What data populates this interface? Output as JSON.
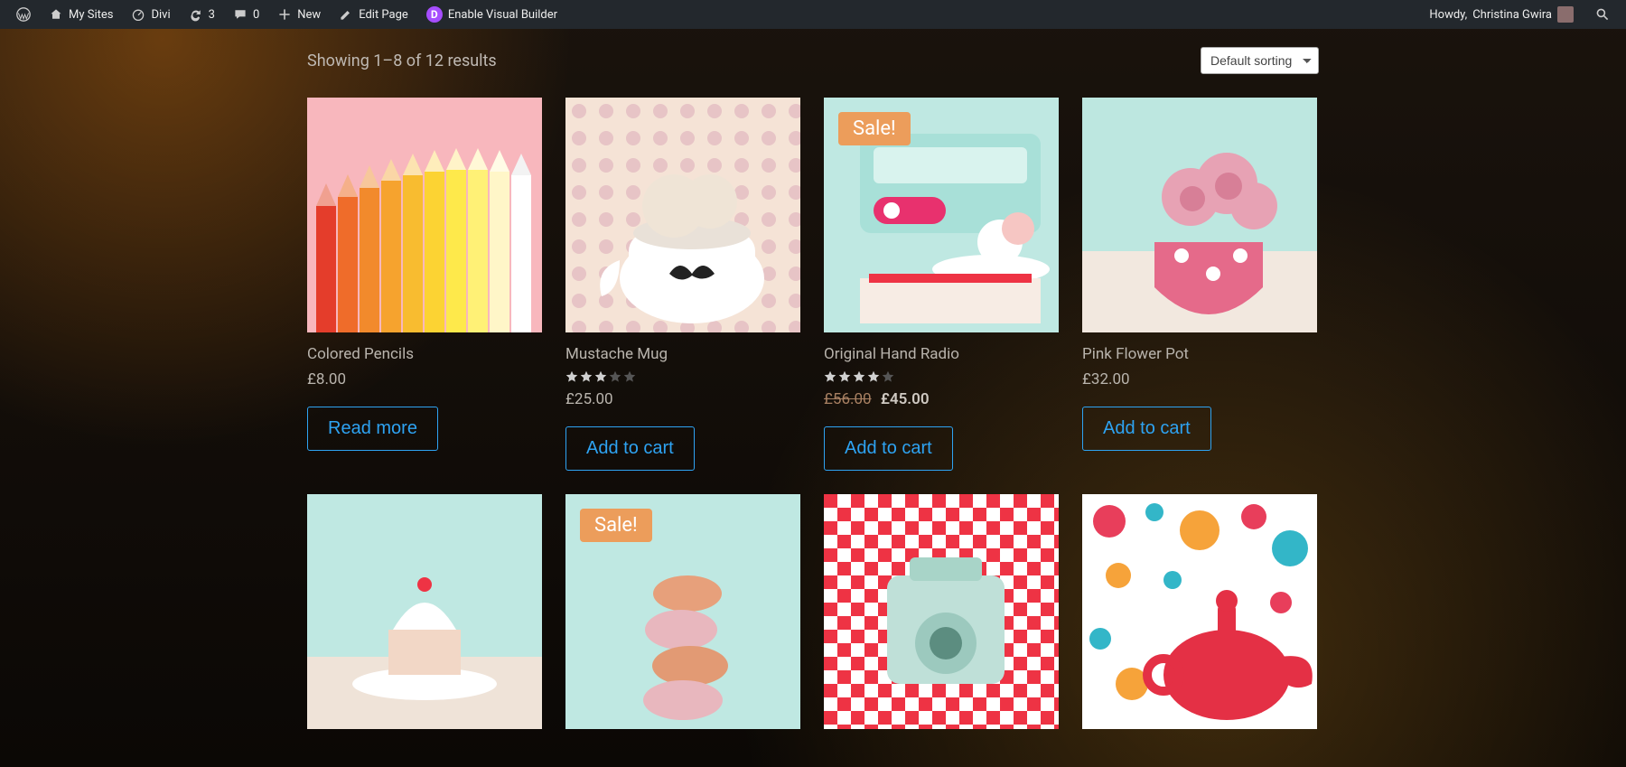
{
  "adminbar": {
    "my_sites": "My Sites",
    "site_name": "Divi",
    "updates_count": "3",
    "comments_count": "0",
    "new": "New",
    "edit_page": "Edit Page",
    "enable_vb": "Enable Visual Builder",
    "howdy_prefix": "Howdy, ",
    "user_name": "Christina Gwira"
  },
  "shop": {
    "result_count": "Showing 1–8 of 12 results",
    "sort_selected": "Default sorting",
    "sale_label": "Sale!",
    "products": [
      {
        "title": "Colored Pencils",
        "price": "£8.00",
        "rating": 0,
        "old_price": "",
        "sale": false,
        "button": "Read more"
      },
      {
        "title": "Mustache Mug",
        "price": "£25.00",
        "rating": 3,
        "old_price": "",
        "sale": false,
        "button": "Add to cart"
      },
      {
        "title": "Original Hand Radio",
        "price": "£45.00",
        "rating": 4,
        "old_price": "£56.00",
        "sale": true,
        "button": "Add to cart"
      },
      {
        "title": "Pink Flower Pot",
        "price": "£32.00",
        "rating": 0,
        "old_price": "",
        "sale": false,
        "button": "Add to cart"
      },
      {
        "title": "",
        "price": "",
        "rating": 0,
        "old_price": "",
        "sale": false,
        "button": ""
      },
      {
        "title": "",
        "price": "",
        "rating": 0,
        "old_price": "",
        "sale": true,
        "button": ""
      },
      {
        "title": "",
        "price": "",
        "rating": 0,
        "old_price": "",
        "sale": false,
        "button": ""
      },
      {
        "title": "",
        "price": "",
        "rating": 0,
        "old_price": "",
        "sale": false,
        "button": ""
      }
    ]
  }
}
